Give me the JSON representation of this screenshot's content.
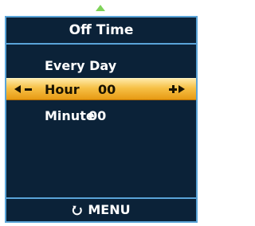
{
  "nav": {
    "up_icon": "triangle-up-icon",
    "up_color": "#7fd35a"
  },
  "header": {
    "title": "Off Time"
  },
  "menu": {
    "items": [
      {
        "label": "Every Day",
        "value": ""
      },
      {
        "label": "Hour",
        "value": "00",
        "selected": true
      },
      {
        "label": "Minute",
        "value": "00"
      }
    ]
  },
  "footer": {
    "icon": "return-icon",
    "label": "MENU"
  },
  "colors": {
    "panel_bg": "#0b2238",
    "border": "#5aa4d8",
    "highlight": "#f6c046",
    "text": "#ffffff"
  }
}
